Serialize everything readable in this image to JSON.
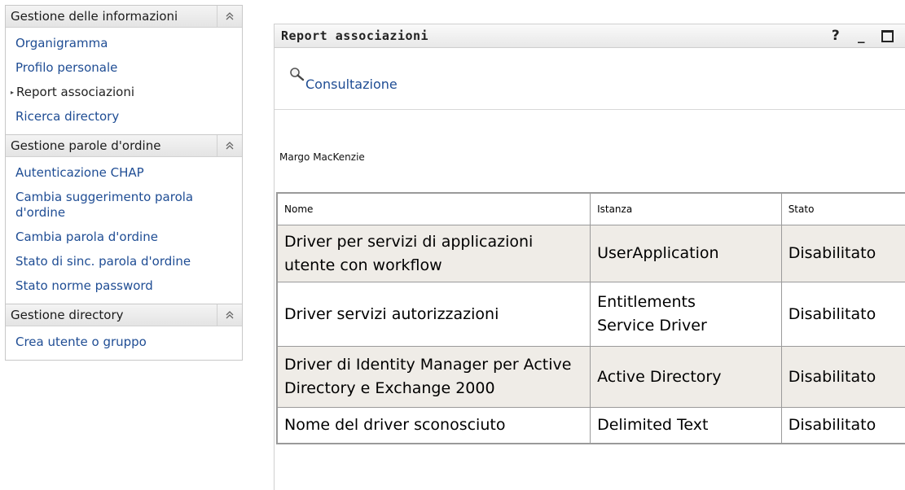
{
  "sidebar": {
    "groups": [
      {
        "title": "Gestione delle informazioni",
        "items": [
          "Organigramma",
          "Profilo personale",
          "Report associazioni",
          "Ricerca directory"
        ]
      },
      {
        "title": "Gestione parole d'ordine",
        "items": [
          "Autenticazione CHAP",
          "Cambia suggerimento parola d'ordine",
          "Cambia parola d'ordine",
          "Stato di sinc. parola d'ordine",
          "Stato norme password"
        ]
      },
      {
        "title": "Gestione directory",
        "items": [
          "Crea utente o gruppo"
        ]
      }
    ],
    "collapse_glyph": "≈",
    "current_marker": "▸"
  },
  "portlet": {
    "title": "Report associazioni",
    "controls": {
      "help": "?",
      "minimize": "_"
    },
    "consult_label": "Consultazione",
    "user_name": "Margo MacKenzie",
    "table": {
      "headers": [
        "Nome",
        "Istanza",
        "Stato"
      ],
      "rows": [
        [
          "Driver per servizi di applicazioni utente con workflow",
          "UserApplication",
          "Disabilitato"
        ],
        [
          "Driver servizi autorizzazioni",
          "Entitlements Service Driver",
          "Disabilitato"
        ],
        [
          "Driver di Identity Manager per Active Directory e Exchange 2000",
          "Active Directory",
          "Disabilitato"
        ],
        [
          "Nome del driver sconosciuto",
          "Delimited Text",
          "Disabilitato"
        ]
      ]
    }
  },
  "icons": {
    "collapse": "double-chevron-up-icon",
    "search": "magnifier-icon",
    "help": "help-icon",
    "minimize": "minimize-icon",
    "maximize": "maximize-icon"
  },
  "colors": {
    "link": "#1f4d94",
    "odd_row": "#efece7",
    "table_border": "#9a9a9a"
  }
}
